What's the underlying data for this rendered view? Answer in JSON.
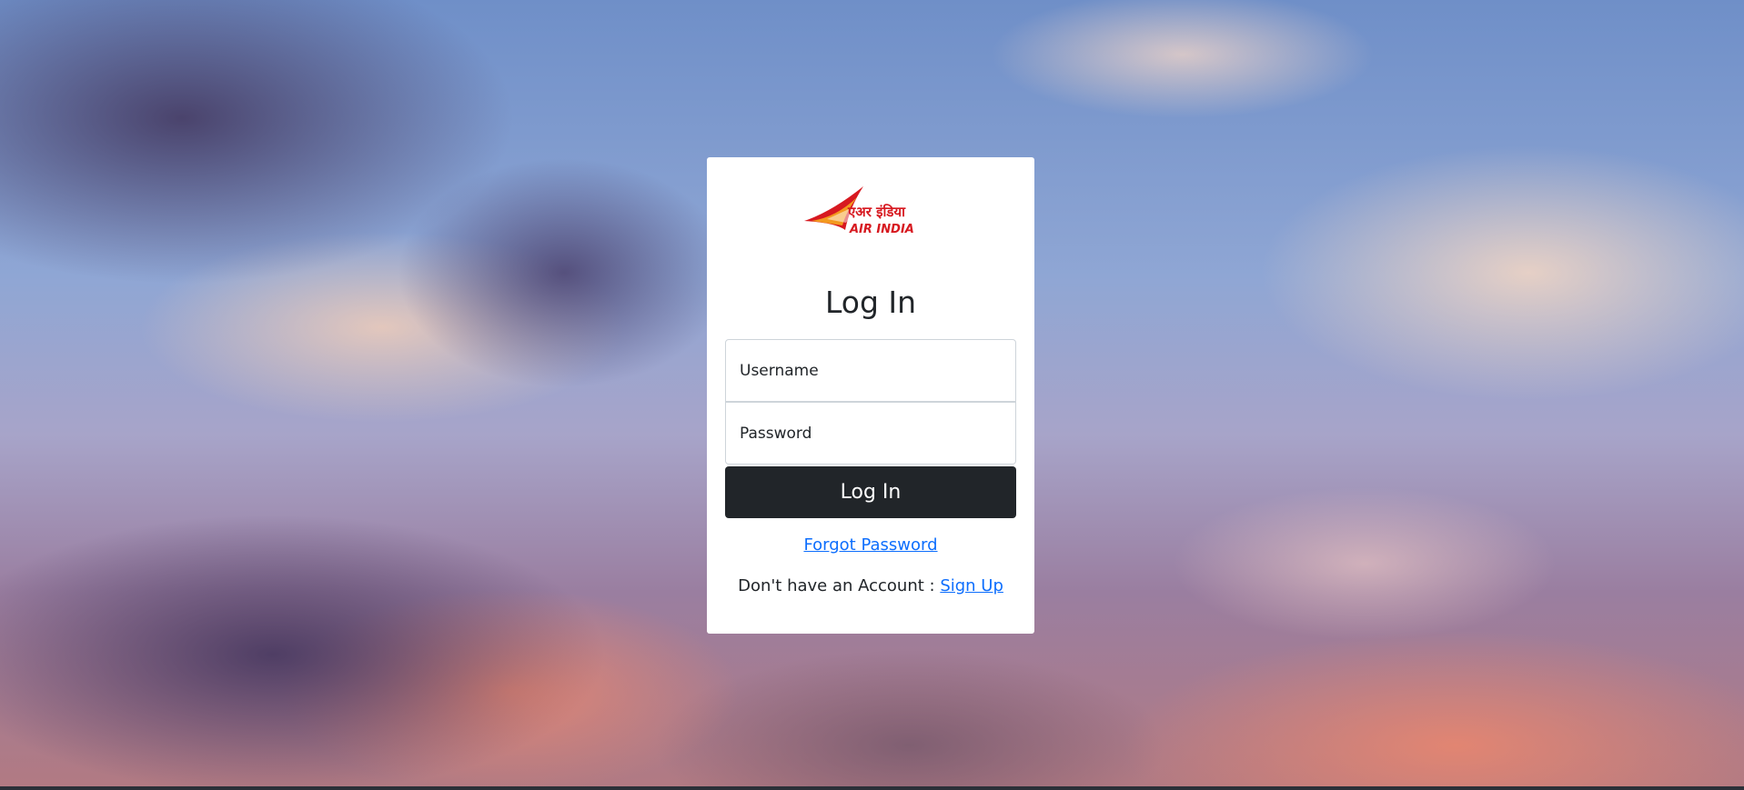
{
  "login": {
    "title": "Log In",
    "username_placeholder": "Username",
    "password_placeholder": "Password",
    "submit_label": "Log In",
    "forgot_password": "Forgot Password",
    "no_account_text": "Don't have an Account : ",
    "signup_link": "Sign Up"
  },
  "logo": {
    "hindi_text": "एअर इंडिया",
    "english_text": "AIR INDIA",
    "brand_color": "#d71920"
  },
  "colors": {
    "button_bg": "#212529",
    "link": "#0d6efd"
  }
}
